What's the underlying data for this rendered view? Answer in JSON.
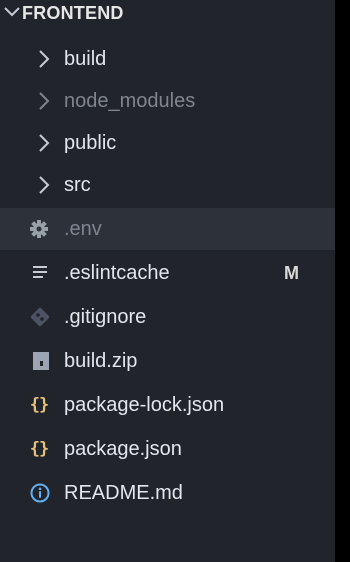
{
  "explorer": {
    "section_title": "FRONTEND",
    "items": [
      {
        "label": "build",
        "type": "folder",
        "dimmed": false
      },
      {
        "label": "node_modules",
        "type": "folder",
        "dimmed": true
      },
      {
        "label": "public",
        "type": "folder",
        "dimmed": false
      },
      {
        "label": "src",
        "type": "folder",
        "dimmed": false
      },
      {
        "label": ".env",
        "type": "file",
        "icon": "gear-icon",
        "dimmed": true,
        "selected": true
      },
      {
        "label": ".eslintcache",
        "type": "file",
        "icon": "lines-icon",
        "badge": "M"
      },
      {
        "label": ".gitignore",
        "type": "file",
        "icon": "git-icon"
      },
      {
        "label": "build.zip",
        "type": "file",
        "icon": "zip-icon"
      },
      {
        "label": "package-lock.json",
        "type": "file",
        "icon": "json-braces-icon",
        "icon_text": "{}"
      },
      {
        "label": "package.json",
        "type": "file",
        "icon": "json-braces-icon",
        "icon_text": "{}"
      },
      {
        "label": "README.md",
        "type": "file",
        "icon": "info-icon"
      }
    ]
  },
  "colors": {
    "background": "#21252b",
    "selected_row": "#2c313a",
    "text": "#e3e6ea",
    "dimmed_text": "#7f848e",
    "json_icon": "#e5c07b",
    "info_icon": "#61afef",
    "git_icon": "#4b5263",
    "zip_icon": "#9da5b4"
  }
}
